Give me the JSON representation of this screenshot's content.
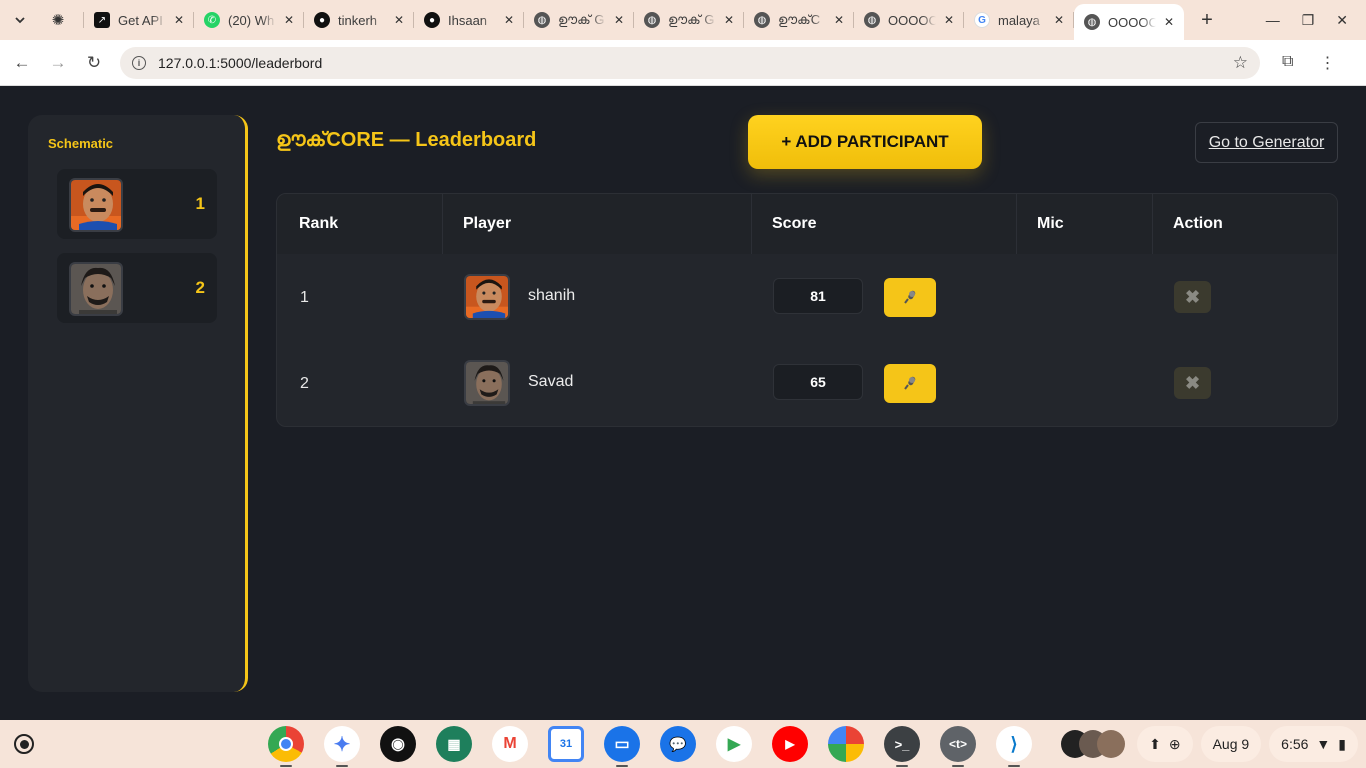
{
  "browser": {
    "tabs": [
      {
        "title": "",
        "favicon": "openai-icon",
        "color": "#333333"
      },
      {
        "title": "Get API",
        "favicon": "api-icon",
        "color": "#111111"
      },
      {
        "title": "(20) Wh",
        "favicon": "whatsapp-icon",
        "color": "#25d366"
      },
      {
        "title": "tinkerh",
        "favicon": "github-icon",
        "color": "#111111"
      },
      {
        "title": "Ihsaan",
        "favicon": "github-icon",
        "color": "#111111"
      },
      {
        "title": "ഊക് G",
        "favicon": "globe-icon",
        "color": "#555555"
      },
      {
        "title": "ഊക് G",
        "favicon": "globe-icon",
        "color": "#555555"
      },
      {
        "title": "ഊക്C",
        "favicon": "globe-icon",
        "color": "#555555"
      },
      {
        "title": "OOOOC",
        "favicon": "globe-icon",
        "color": "#555555"
      },
      {
        "title": "malaya",
        "favicon": "google-icon",
        "color": "#4285f4"
      },
      {
        "title": "OOOOC",
        "favicon": "globe-icon",
        "color": "#555555",
        "active": true
      }
    ],
    "url": "127.0.0.1:5000/leaderbord"
  },
  "sidebar": {
    "title": "Schematic",
    "items": [
      {
        "rank": "1",
        "avatar": "shanih"
      },
      {
        "rank": "2",
        "avatar": "savad"
      }
    ]
  },
  "header": {
    "title": "ഊക്CORE — Leaderboard",
    "add_button": "+ ADD PARTICIPANT",
    "generator_link": "Go to Generator"
  },
  "table": {
    "columns": [
      "Rank",
      "Player",
      "Score",
      "Mic",
      "Action"
    ],
    "rows": [
      {
        "rank": "1",
        "player": "shanih",
        "score": "81",
        "mic_icon": "microphone-icon",
        "action_icon": "delete-x-icon"
      },
      {
        "rank": "2",
        "player": "Savad",
        "score": "65",
        "mic_icon": "microphone-icon",
        "action_icon": "delete-x-icon"
      }
    ]
  },
  "shelf": {
    "apps": [
      "chrome",
      "gemini",
      "podcasts",
      "app-grid",
      "gmail",
      "calendar",
      "files",
      "messages",
      "play-store",
      "youtube",
      "photos",
      "terminal",
      "text",
      "vscode"
    ],
    "date": "Aug 9",
    "time": "6:56",
    "calendar_day": "31"
  },
  "colors": {
    "accent": "#f5c518",
    "background": "#1b1e25",
    "panel": "#23262c"
  }
}
